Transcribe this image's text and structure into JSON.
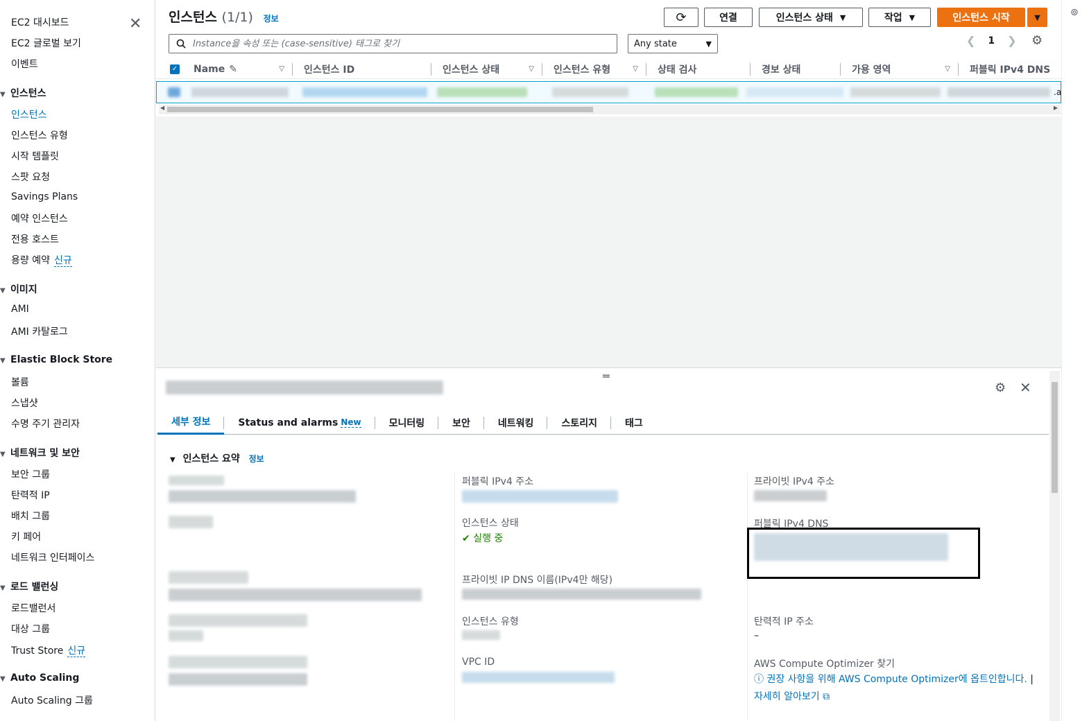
{
  "sidebar": {
    "close_icon": "close-icon",
    "top_items": [
      "EC2 대시보드",
      "EC2 글로벌 보기",
      "이벤트"
    ],
    "sections": [
      {
        "title": "인스턴스",
        "items": [
          "인스턴스",
          "인스턴스 유형",
          "시작 템플릿",
          "스팟 요청",
          "Savings Plans",
          "예약 인스턴스",
          "전용 호스트",
          "용량 예약"
        ]
      },
      {
        "title": "이미지",
        "items": [
          "AMI",
          "AMI 카탈로그"
        ]
      },
      {
        "title": "Elastic Block Store",
        "items": [
          "볼륨",
          "스냅샷",
          "수명 주기 관리자"
        ]
      },
      {
        "title": "네트워크 및 보안",
        "items": [
          "보안 그룹",
          "탄력적 IP",
          "배치 그룹",
          "키 페어",
          "네트워크 인터페이스"
        ]
      },
      {
        "title": "로드 밸런싱",
        "items": [
          "로드밸런서",
          "대상 그룹",
          "Trust Store"
        ]
      },
      {
        "title": "Auto Scaling",
        "items": [
          "Auto Scaling 그룹"
        ]
      }
    ],
    "new_badge": "신규",
    "active_item": "인스턴스"
  },
  "header": {
    "title": "인스턴스",
    "count": "(1/1)",
    "info": "정보",
    "buttons": {
      "refresh_icon": "refresh-icon",
      "connect": "연결",
      "instance_state": "인스턴스 상태",
      "actions": "작업",
      "launch": "인스턴스 시작"
    }
  },
  "search": {
    "placeholder": "Instance을 속성 또는 (case-sensitive) 태그로 찾기",
    "state_filter": "Any state"
  },
  "pagination": {
    "page": "1"
  },
  "table": {
    "columns": [
      "Name",
      "인스턴스 ID",
      "인스턴스 상태",
      "인스턴스 유형",
      "상태 검사",
      "경보 상태",
      "가용 영역",
      "퍼블릭 IPv4 DNS"
    ],
    "row_suffix": ".a"
  },
  "detail": {
    "tabs": [
      "세부 정보",
      "Status and alarms",
      "모니터링",
      "보안",
      "네트워킹",
      "스토리지",
      "태그"
    ],
    "tab_new_badge": "New",
    "section_title": "인스턴스 요약",
    "section_info": "정보",
    "fields": {
      "public_ipv4": "퍼블릭 IPv4 주소",
      "private_ipv4": "프라이빗 IPv4 주소",
      "instance_state": "인스턴스 상태",
      "instance_state_value": "실행 중",
      "public_dns": "퍼블릭 IPv4 DNS",
      "private_dns": "프라이빗 IP DNS 이름(IPv4만 해당)",
      "instance_type": "인스턴스 유형",
      "elastic_ip": "탄력적 IP 주소",
      "elastic_ip_value": "–",
      "vpc_id": "VPC ID",
      "optimizer": "AWS Compute Optimizer 찾기",
      "optimizer_msg_link": "권장 사항을 위해 AWS Compute Optimizer에 옵트인합니다.",
      "optimizer_sep": "|",
      "learn_more": "자세히 알아보기"
    }
  },
  "colors": {
    "accent": "#0073bb",
    "primary": "#ec7211",
    "running": "#1d8102"
  }
}
